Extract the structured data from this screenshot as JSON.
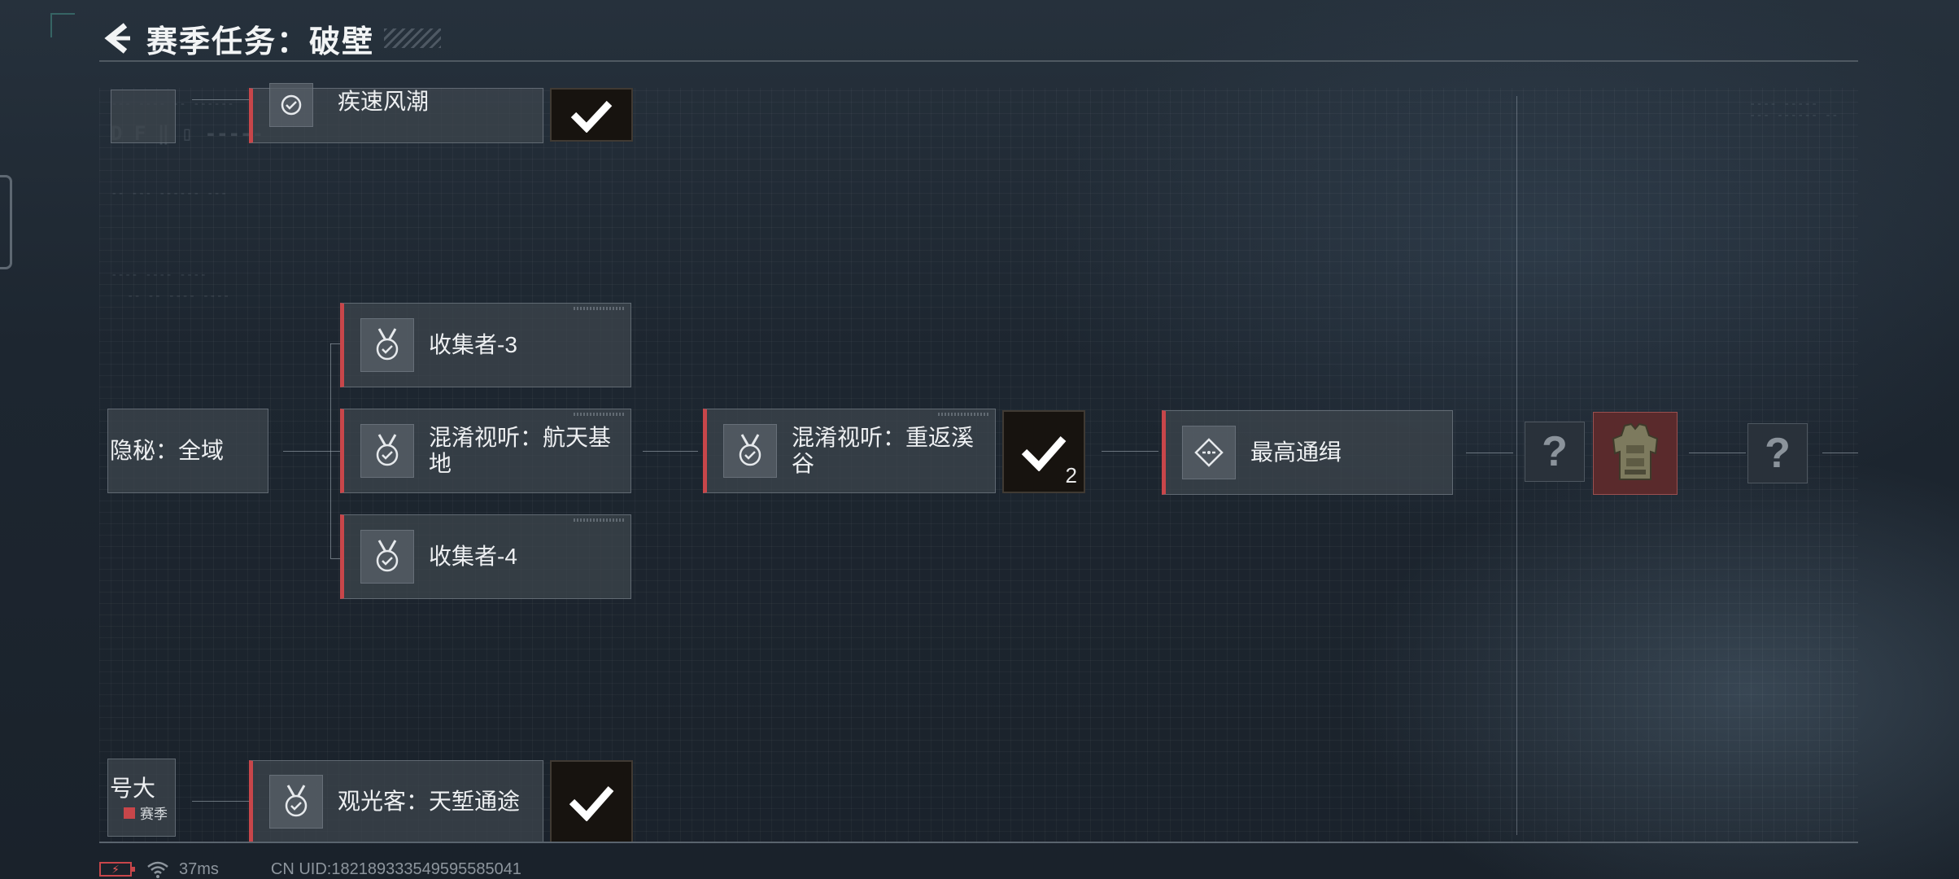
{
  "header": {
    "title": "赛季任务：破壁"
  },
  "cards": {
    "top_partial": "疾速风潮",
    "left_partial": "隐秘：全域",
    "collector3": "收集者-3",
    "mix_base": "混淆视听：航天基地",
    "collector4": "收集者-4",
    "mix_valley": "混淆视听：重返溪谷",
    "wanted": "最高通缉",
    "bottom_partial": "观光客：天堑通途",
    "bottom_left_partial": "号大",
    "season_tag": "赛季"
  },
  "rewards": {
    "mix_valley_count": "2",
    "unknown_mark": "?",
    "armor_icon": "body-armor-icon"
  },
  "status": {
    "ping": "37ms",
    "uid": "CN UID:18218933354959558504​1"
  },
  "colors": {
    "accent_red": "#c8464a",
    "armor_bg": "#5a2a2c",
    "check_tile_bg": "#17130f"
  }
}
